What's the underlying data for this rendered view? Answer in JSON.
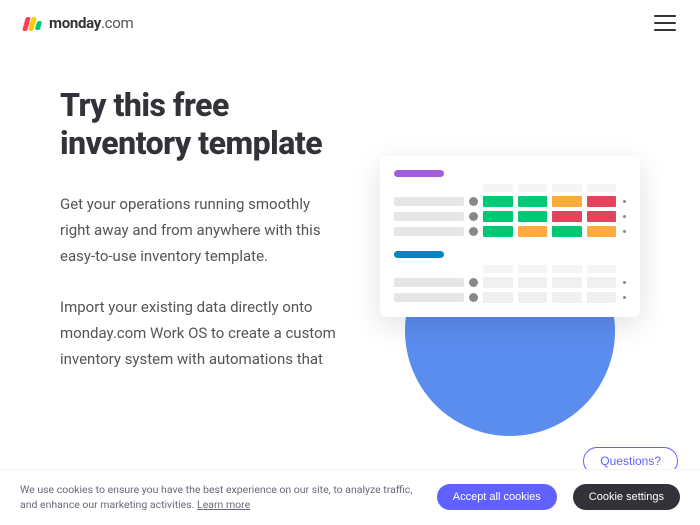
{
  "brand": {
    "name_bold": "monday",
    "name_light": ".com"
  },
  "hero": {
    "title": "Try this free inventory template",
    "para1": "Get your operations running smoothly right away and from anywhere with this easy-to-use inventory template.",
    "para2": "Import your existing data directly onto monday.com Work OS to create a custom inventory system with automations that"
  },
  "help": {
    "questions_label": "Questions?"
  },
  "cookie": {
    "text_a": "We use cookies to ensure you have the best experience on our site, to analyze traffic, and enhance our marketing activities. ",
    "learn": "Learn more",
    "accept": "Accept all cookies",
    "settings": "Cookie settings"
  },
  "illustration": {
    "cells_group1": [
      [
        "green",
        "green",
        "orange",
        "red"
      ],
      [
        "green",
        "green",
        "red",
        "red"
      ],
      [
        "green",
        "orange",
        "green",
        "orange"
      ]
    ],
    "cells_group2": [
      [
        "empty",
        "empty",
        "empty",
        "empty"
      ],
      [
        "empty",
        "empty",
        "empty",
        "empty"
      ]
    ]
  }
}
